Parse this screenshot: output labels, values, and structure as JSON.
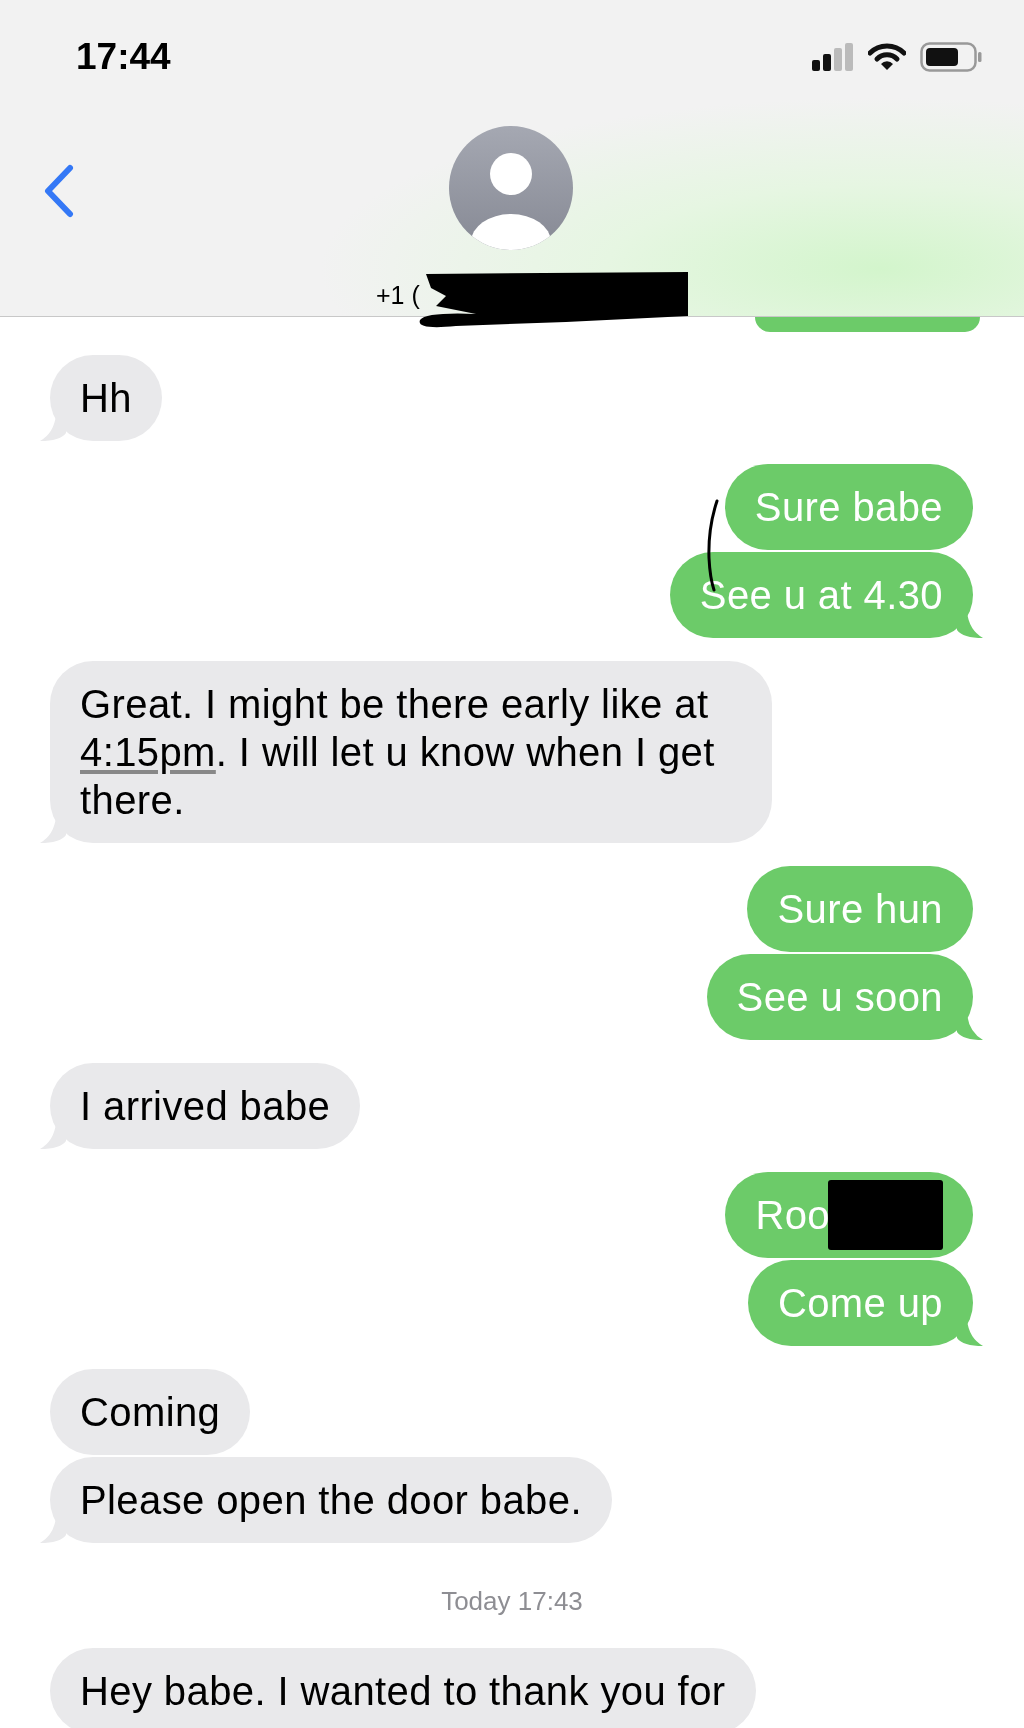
{
  "status_bar": {
    "time": "17:44"
  },
  "header": {
    "number": "+1 (",
    "number_redacted": true
  },
  "thread": [
    {
      "kind": "incoming",
      "bubbles": [
        {
          "text": "Hh"
        }
      ]
    },
    {
      "kind": "outgoing",
      "bubbles": [
        {
          "text": "Sure babe"
        },
        {
          "text": "See u at 4.30"
        }
      ]
    },
    {
      "kind": "incoming",
      "bubbles": [
        {
          "parts": [
            {
              "text": "Great. I might be there early like at ",
              "link": false
            },
            {
              "text": "4:15pm",
              "link": true
            },
            {
              "text": ". I will let u know when I get there.",
              "link": false
            }
          ]
        }
      ]
    },
    {
      "kind": "outgoing",
      "bubbles": [
        {
          "text": "Sure hun"
        },
        {
          "text": "See u soon"
        }
      ]
    },
    {
      "kind": "incoming",
      "bubbles": [
        {
          "text": "I arrived babe"
        }
      ]
    },
    {
      "kind": "outgoing",
      "bubbles": [
        {
          "text": "Roo",
          "redacted": true
        },
        {
          "text": "Come up"
        }
      ]
    },
    {
      "kind": "incoming",
      "bubbles": [
        {
          "text": "Coming"
        },
        {
          "text": "Please open the door babe."
        }
      ]
    },
    {
      "kind": "timestamp",
      "text": "Today 17:43"
    },
    {
      "kind": "incoming",
      "bubbles": [
        {
          "text": "Hey babe. I wanted to thank you for"
        }
      ]
    }
  ]
}
